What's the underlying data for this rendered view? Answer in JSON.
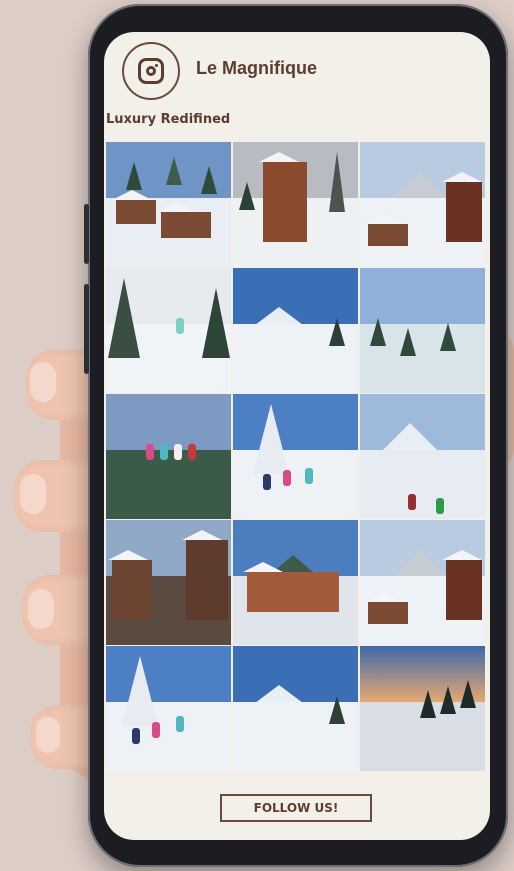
{
  "profile": {
    "name": "Le Magnifique",
    "tagline": "Luxury Redifined",
    "icon": "instagram-icon"
  },
  "cta": {
    "label": "FOLLOW US!"
  },
  "photos": [
    {
      "subject": "chalets-forest"
    },
    {
      "subject": "wooden-chalet"
    },
    {
      "subject": "dolomites-village"
    },
    {
      "subject": "chairlift-trees"
    },
    {
      "subject": "ski-slope"
    },
    {
      "subject": "valley-runs"
    },
    {
      "subject": "family-chairlift"
    },
    {
      "subject": "family-snow"
    },
    {
      "subject": "skiers-peaks"
    },
    {
      "subject": "town-street"
    },
    {
      "subject": "hotel-mountains"
    },
    {
      "subject": "dolomites-village"
    },
    {
      "subject": "family-snow"
    },
    {
      "subject": "ski-slope"
    },
    {
      "subject": "sunset-forest"
    }
  ],
  "colors": {
    "brand": "#5c3d30",
    "background": "#dccdc6",
    "screen": "#f3efe9"
  }
}
